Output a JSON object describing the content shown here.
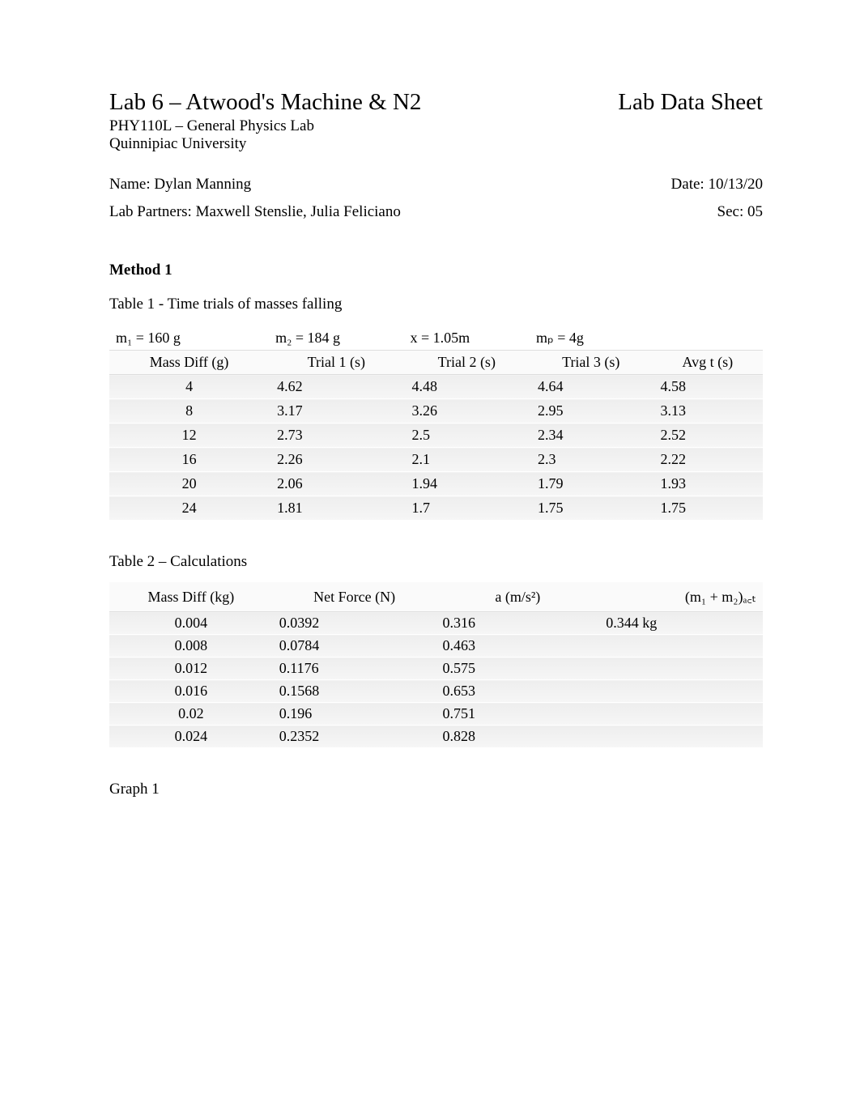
{
  "header": {
    "title": "Lab 6 – Atwood's Machine & N2",
    "sheet": "Lab Data Sheet",
    "course": "PHY110L – General Physics Lab",
    "school": "Quinnipiac University",
    "name_label": "Name: Dylan Manning",
    "date_label": "Date: 10/13/20",
    "partners_label": "Lab Partners: Maxwell Stenslie, Julia Feliciano",
    "sec_label": "Sec: 05"
  },
  "method1": {
    "heading": "Method 1",
    "table1_caption": "Table 1 - Time trials of masses falling",
    "params": {
      "m1": "m₁ = 160 g",
      "m2": "m₂ = 184 g",
      "x": "x  = 1.05m",
      "mp": "mₚ = 4g"
    },
    "columns": {
      "mass_diff": "Mass Diff (g)",
      "t1": "Trial 1    (s)",
      "t2": "Trial 2    (s)",
      "t3": "Trial 3    (s)",
      "avg": "Avg t (s)"
    },
    "rows": [
      {
        "m": "4",
        "t1": "4.62",
        "t2": "4.48",
        "t3": "4.64",
        "avg": "4.58"
      },
      {
        "m": "8",
        "t1": "3.17",
        "t2": "3.26",
        "t3": "2.95",
        "avg": "3.13"
      },
      {
        "m": "12",
        "t1": "2.73",
        "t2": "2.5",
        "t3": "2.34",
        "avg": "2.52"
      },
      {
        "m": "16",
        "t1": "2.26",
        "t2": "2.1",
        "t3": "2.3",
        "avg": "2.22"
      },
      {
        "m": "20",
        "t1": "2.06",
        "t2": "1.94",
        "t3": "1.79",
        "avg": "1.93"
      },
      {
        "m": "24",
        "t1": "1.81",
        "t2": "1.7",
        "t3": "1.75",
        "avg": "1.75"
      }
    ],
    "table2_caption": "Table 2 – Calculations",
    "columns2": {
      "mass_diff_kg": "Mass Diff (kg)",
      "net_force": "Net Force (N)",
      "accel": "a (m/s²)",
      "m1m2": "(m₁ + m₂)ₐ꜀ₜ"
    },
    "rows2": [
      {
        "m": "0.004",
        "f": "0.0392",
        "a": "0.316",
        "mm": "0.344 kg"
      },
      {
        "m": "0.008",
        "f": "0.0784",
        "a": "0.463",
        "mm": ""
      },
      {
        "m": "0.012",
        "f": "0.1176",
        "a": "0.575",
        "mm": ""
      },
      {
        "m": "0.016",
        "f": "0.1568",
        "a": "0.653",
        "mm": ""
      },
      {
        "m": "0.02",
        "f": "0.196",
        "a": "0.751",
        "mm": ""
      },
      {
        "m": "0.024",
        "f": "0.2352",
        "a": "0.828",
        "mm": ""
      }
    ],
    "graph_label": "Graph 1"
  }
}
